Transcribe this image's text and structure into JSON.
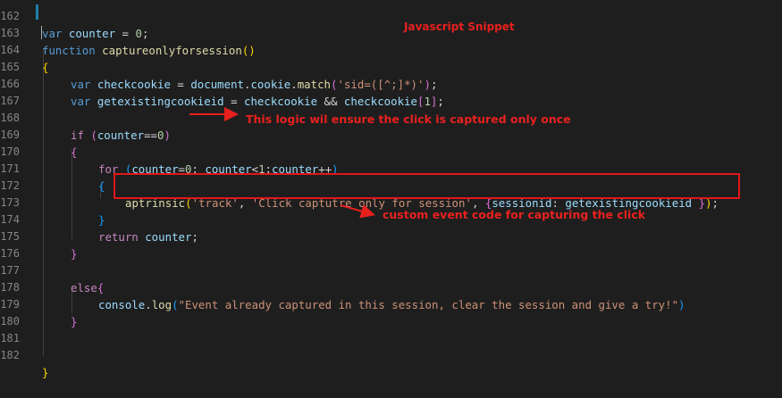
{
  "editor": {
    "line_numbers": [
      "162",
      "163",
      "164",
      "165",
      "166",
      "167",
      "168",
      "169",
      "170",
      "171",
      "172",
      "173",
      "174",
      "175",
      "176",
      "177",
      "178",
      "179",
      "180",
      "181",
      "182"
    ],
    "lines": {
      "l162": {
        "kw": "var",
        "name": "counter",
        "eq": " = ",
        "num": "0",
        "end": ";"
      },
      "l163": {
        "kw": "function",
        "name": "captureonlyforsession",
        "paren_open": "(",
        "paren_close": ")"
      },
      "l164": {
        "brace": "{"
      },
      "l165": {
        "kw": "var",
        "name": "checkcookie",
        "eq": " = ",
        "obj": "document",
        "dot1": ".",
        "prop": "cookie",
        "dot2": ".",
        "method": "match",
        "po": "(",
        "arg": "'sid=([^;]*)'",
        "pc": ")",
        "end": ";"
      },
      "l166": {
        "kw": "var",
        "name": "getexistingcookieid",
        "eq": " = ",
        "ref1": "checkcookie",
        "and": " && ",
        "ref2": "checkcookie",
        "bo": "[",
        "idx": "1",
        "bc": "]",
        "end": ";"
      },
      "l168": {
        "kw": "if",
        "po": " (",
        "var": "counter",
        "op": "==",
        "num": "0",
        "pc": ")"
      },
      "l169": {
        "brace": "{"
      },
      "l170": {
        "kw": "for",
        "po": " (",
        "v1": "counter",
        "eq": "=",
        "n1": "0",
        "semi1": "; ",
        "v2": "counter",
        "lt": "<",
        "n2": "1",
        "semi2": ";",
        "v3": "counter",
        "inc": "++",
        "pc": ")"
      },
      "l171": {
        "brace": "{"
      },
      "l172": {
        "fn": "aptrinsic",
        "po": "(",
        "s1": "'track'",
        "c1": ", ",
        "s2": "'Click captutre only for session'",
        "c2": ", ",
        "bo": "{",
        "key": "sessionid",
        "colon": ": ",
        "val": "getexistingcookieid",
        "bc": " }",
        "pc": ")",
        "end": ";"
      },
      "l173": {
        "brace": "}"
      },
      "l174": {
        "kw": "return",
        "var": " counter",
        "end": ";"
      },
      "l175": {
        "brace": "}"
      },
      "l177": {
        "kw": "else",
        "brace": "{"
      },
      "l178": {
        "obj": "console",
        "dot": ".",
        "fn": "log",
        "po": "(",
        "str": "\"Event already captured in this session, clear the session and give a try!\"",
        "pc": ")"
      },
      "l179": {
        "brace": "}"
      },
      "l182": {
        "brace": "}"
      }
    }
  },
  "annotations": {
    "title": "Javascript Snippet",
    "note_once": "This logic wil ensure the click is captured only once",
    "note_custom": "custom event code for capturing the click"
  },
  "colors": {
    "annotation": "#e8211f",
    "background": "#1e1e1e",
    "keyword": "#569cd6",
    "control": "#c586c0",
    "function": "#dcdcaa",
    "variable": "#9cdcfe",
    "string": "#ce9178",
    "number": "#b5cea8"
  }
}
